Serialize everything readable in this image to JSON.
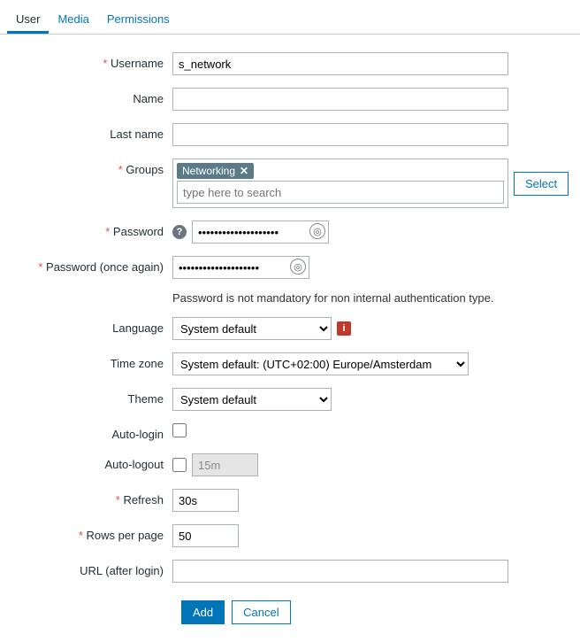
{
  "tabs": {
    "user": "User",
    "media": "Media",
    "permissions": "Permissions"
  },
  "labels": {
    "username": "Username",
    "name": "Name",
    "lastname": "Last name",
    "groups": "Groups",
    "password": "Password",
    "password2": "Password (once again)",
    "language": "Language",
    "timezone": "Time zone",
    "theme": "Theme",
    "autologin": "Auto-login",
    "autologout": "Auto-logout",
    "refresh": "Refresh",
    "rowsperpage": "Rows per page",
    "urlafterlogin": "URL (after login)"
  },
  "values": {
    "username": "s_network",
    "name": "",
    "lastname": "",
    "group_chip": "Networking",
    "groups_placeholder": "type here to search",
    "password": "••••••••••••••••••••",
    "password2": "••••••••••••••••••••",
    "password_note": "Password is not mandatory for non internal authentication type.",
    "language": "System default",
    "timezone": "System default: (UTC+02:00) Europe/Amsterdam",
    "theme": "System default",
    "autologout_value": "15m",
    "refresh": "30s",
    "rowsperpage": "50",
    "urlafterlogin": ""
  },
  "buttons": {
    "select": "Select",
    "add": "Add",
    "cancel": "Cancel"
  },
  "icons": {
    "help": "?",
    "info": "i",
    "close": "✕"
  }
}
